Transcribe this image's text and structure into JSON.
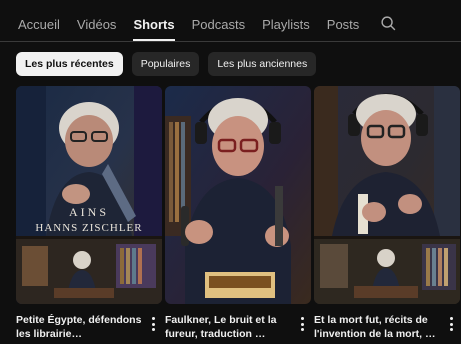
{
  "tabs": [
    {
      "label": "Accueil"
    },
    {
      "label": "Vidéos"
    },
    {
      "label": "Shorts",
      "active": true
    },
    {
      "label": "Podcasts"
    },
    {
      "label": "Playlists"
    },
    {
      "label": "Posts"
    }
  ],
  "search_icon": "search-icon",
  "filters": [
    {
      "label": "Les plus récentes",
      "selected": true
    },
    {
      "label": "Populaires"
    },
    {
      "label": "Les plus anciennes"
    }
  ],
  "shorts": [
    {
      "caption": "Petite Égypte, défendons les librairie…",
      "overlay_line1": "AINS",
      "overlay_line2": "HANNS ZISCHLER"
    },
    {
      "caption": "Faulkner, Le bruit et la fureur, traduction …"
    },
    {
      "caption": "Et la mort fut, récits de l'invention de la mort, …"
    }
  ],
  "colors": {
    "background": "#0f0f0f",
    "chip_bg": "#272727",
    "chip_selected_bg": "#f1f1f1",
    "text": "#f1f1f1",
    "muted_text": "#aaaaaa"
  }
}
